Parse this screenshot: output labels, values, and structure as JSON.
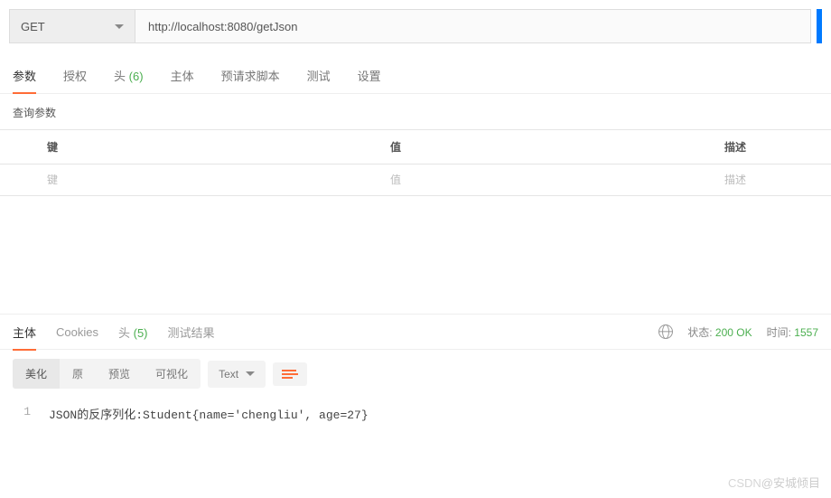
{
  "request": {
    "method": "GET",
    "url": "http://localhost:8080/getJson"
  },
  "req_tabs": {
    "params": "参数",
    "auth": "授权",
    "headers_label": "头",
    "headers_count": "(6)",
    "body": "主体",
    "prereq": "预请求脚本",
    "tests": "测试",
    "settings": "设置"
  },
  "params": {
    "section_label": "查询参数",
    "header_key": "键",
    "header_value": "值",
    "header_desc": "描述",
    "placeholder_key": "键",
    "placeholder_value": "值",
    "placeholder_desc": "描述"
  },
  "resp_tabs": {
    "body": "主体",
    "cookies": "Cookies",
    "headers_label": "头",
    "headers_count": "(5)",
    "test_results": "测试结果"
  },
  "resp_meta": {
    "status_label": "状态:",
    "status_value": "200 OK",
    "time_label": "时间:",
    "time_value": "1557"
  },
  "resp_toolbar": {
    "pretty": "美化",
    "raw": "原",
    "preview": "预览",
    "visualize": "可视化",
    "format": "Text"
  },
  "resp_body": {
    "line_no": "1",
    "content": "JSON的反序列化:Student{name='chengliu', age=27}"
  },
  "watermark": {
    "left": "CSDN",
    "right": "@安城倾目"
  }
}
